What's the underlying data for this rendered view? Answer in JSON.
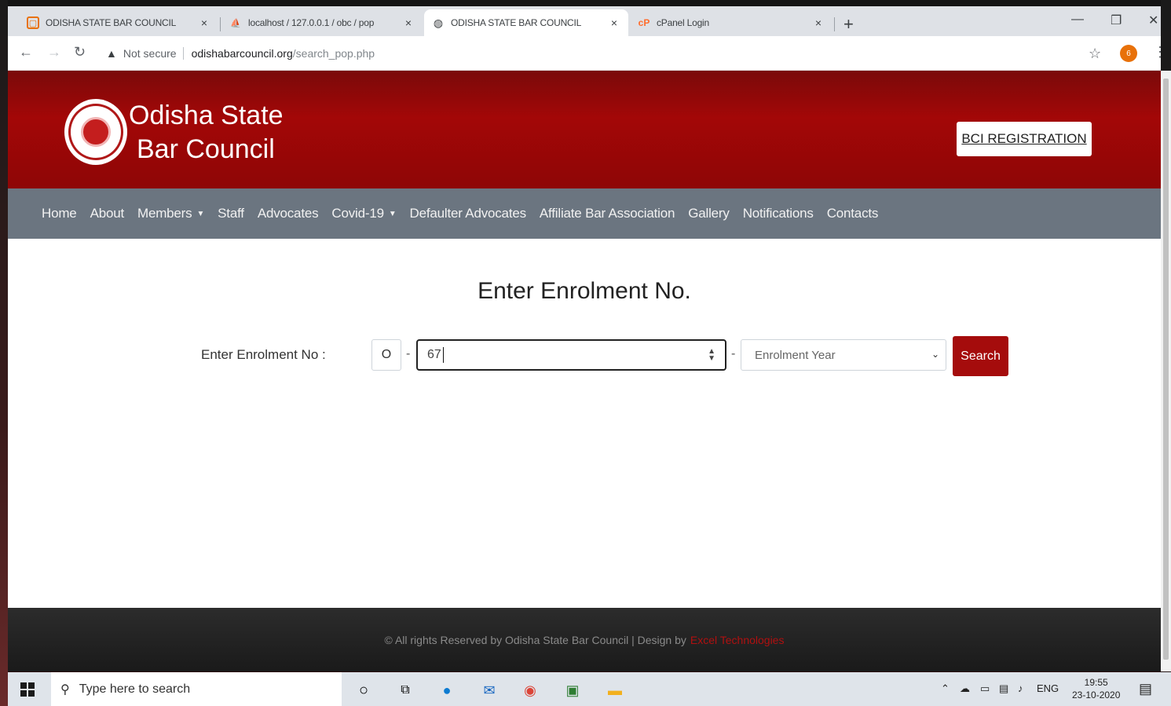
{
  "browser": {
    "tabs": [
      {
        "title": "ODISHA STATE BAR COUNCIL",
        "active": false
      },
      {
        "title": "localhost / 127.0.0.1 / obc / pop",
        "active": false
      },
      {
        "title": "ODISHA STATE BAR COUNCIL",
        "active": true
      },
      {
        "title": "cPanel Login",
        "active": false
      }
    ],
    "tab_close": "×",
    "new_tab": "+",
    "window_controls": {
      "minimize": "—",
      "restore": "❐",
      "close": "✕"
    },
    "security_label": "Not secure",
    "url_host": "odishabarcouncil.org",
    "url_path": "/search_pop.php",
    "profile_initial": "6"
  },
  "site": {
    "brand_line1": "Odisha State",
    "brand_line2": "Bar Council",
    "bci_button": "BCI REGISTRATION",
    "nav": [
      {
        "label": "Home",
        "dropdown": false
      },
      {
        "label": "About",
        "dropdown": false
      },
      {
        "label": "Members",
        "dropdown": true
      },
      {
        "label": "Staff",
        "dropdown": false
      },
      {
        "label": "Advocates",
        "dropdown": false
      },
      {
        "label": "Covid-19",
        "dropdown": true
      },
      {
        "label": "Defaulter Advocates",
        "dropdown": false
      },
      {
        "label": "Affiliate Bar Association",
        "dropdown": false
      },
      {
        "label": "Gallery",
        "dropdown": false
      },
      {
        "label": "Notifications",
        "dropdown": false
      },
      {
        "label": "Contacts",
        "dropdown": false
      }
    ]
  },
  "form": {
    "title": "Enter Enrolment No.",
    "label": "Enter Enrolment No :",
    "prefix": "O",
    "separator": "-",
    "enrolment_value": "67",
    "year_placeholder": "Enrolment Year",
    "search_button": "Search"
  },
  "footer": {
    "text": "© All rights Reserved by Odisha State Bar Council | Design by",
    "designer": "Excel Technologies"
  },
  "taskbar": {
    "search_placeholder": "Type here to search",
    "language": "ENG",
    "time": "19:55",
    "date": "23-10-2020"
  },
  "colors": {
    "header_red": "#a30707",
    "nav_gray": "#6b7580",
    "search_button": "#a50c0c"
  }
}
